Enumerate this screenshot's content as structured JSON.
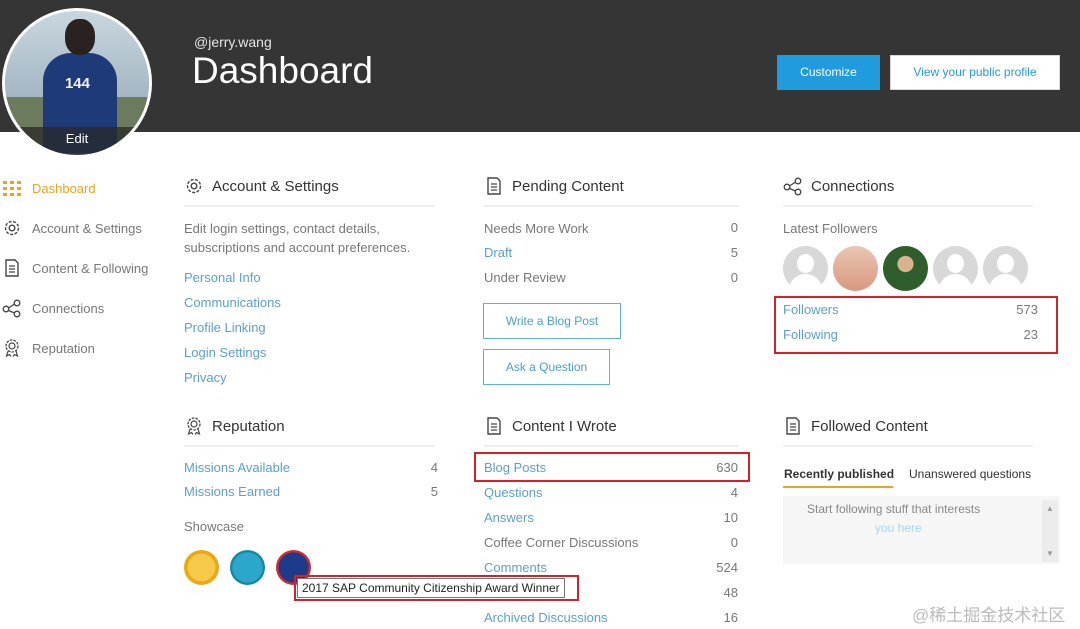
{
  "header": {
    "handle": "@jerry.wang",
    "title": "Dashboard",
    "avatar_edit": "Edit",
    "avatar_jersey": "144",
    "customize_label": "Customize",
    "view_profile_label": "View your public profile"
  },
  "sidebar": {
    "items": [
      {
        "label": "Dashboard",
        "icon": "grid-icon",
        "active": true
      },
      {
        "label": "Account & Settings",
        "icon": "gear-icon"
      },
      {
        "label": "Content & Following",
        "icon": "document-icon"
      },
      {
        "label": "Connections",
        "icon": "share-icon"
      },
      {
        "label": "Reputation",
        "icon": "badge-icon"
      }
    ]
  },
  "account": {
    "title": "Account & Settings",
    "desc_line1": "Edit login settings, contact details,",
    "desc_line2": "subscriptions and account preferences.",
    "links": [
      "Personal Info",
      "Communications",
      "Profile Linking",
      "Login Settings",
      "Privacy"
    ]
  },
  "pending": {
    "title": "Pending Content",
    "rows": [
      {
        "label": "Needs More Work",
        "count": "0"
      },
      {
        "label": "Draft",
        "count": "5"
      },
      {
        "label": "Under Review",
        "count": "0"
      }
    ],
    "write_blog_label": "Write a Blog Post",
    "ask_question_label": "Ask a Question"
  },
  "connections": {
    "title": "Connections",
    "latest_label": "Latest Followers",
    "followers_label": "Followers",
    "followers_count": "573",
    "following_label": "Following",
    "following_count": "23"
  },
  "reputation": {
    "title": "Reputation",
    "rows": [
      {
        "label": "Missions Available",
        "count": "4"
      },
      {
        "label": "Missions Earned",
        "count": "5"
      }
    ],
    "showcase_label": "Showcase",
    "tooltip": "2017 SAP Community Citizenship Award Winner"
  },
  "content_wrote": {
    "title": "Content I Wrote",
    "rows": [
      {
        "label": "Blog Posts",
        "count": "630"
      },
      {
        "label": "Questions",
        "count": "4"
      },
      {
        "label": "Answers",
        "count": "10"
      },
      {
        "label": "Coffee Corner Discussions",
        "count": "0"
      },
      {
        "label": "Comments",
        "count": "524"
      },
      {
        "label": "",
        "count": "48"
      },
      {
        "label": "Archived Discussions",
        "count": "16"
      }
    ]
  },
  "followed": {
    "title": "Followed Content",
    "tab_recent": "Recently published",
    "tab_unanswered": "Unanswered questions",
    "empty_line1": "Start following stuff that interests",
    "empty_line2": "you here"
  },
  "watermark": "@稀土掘金技术社区",
  "colors": {
    "accent_orange": "#f0a21b",
    "link_blue": "#5b9fce",
    "header_bg": "#353535",
    "highlight_red": "#d2232a"
  }
}
